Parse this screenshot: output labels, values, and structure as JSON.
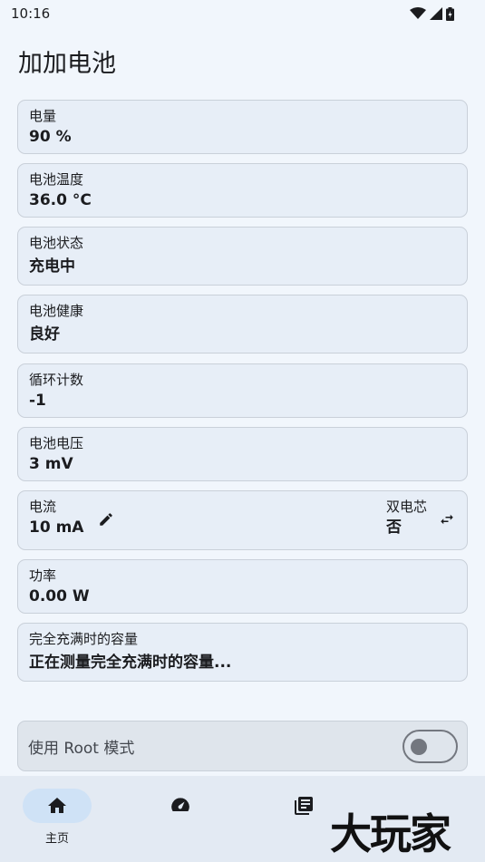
{
  "status": {
    "time": "10:16"
  },
  "app": {
    "title": "加加电池"
  },
  "cards": {
    "level": {
      "label": "电量",
      "value": "90 %"
    },
    "temperature": {
      "label": "电池温度",
      "value": "36.0 °C"
    },
    "status": {
      "label": "电池状态",
      "value": "充电中"
    },
    "health": {
      "label": "电池健康",
      "value": "良好"
    },
    "cycles": {
      "label": "循环计数",
      "value": "-1"
    },
    "voltage": {
      "label": "电池电压",
      "value": "3 mV"
    },
    "current": {
      "label": "电流",
      "value": "10 mA",
      "dual_label": "双电芯",
      "dual_value": "否"
    },
    "power": {
      "label": "功率",
      "value": "0.00 W"
    },
    "full_capacity": {
      "label": "完全充满时的容量",
      "value": "正在测量完全充满时的容量..."
    }
  },
  "root_mode": {
    "label": "使用 Root 模式",
    "enabled": false
  },
  "nav": {
    "items": [
      {
        "label": "主页",
        "icon": "home-icon",
        "active": true
      },
      {
        "label": "",
        "icon": "speedometer-icon",
        "active": false
      },
      {
        "label": "",
        "icon": "history-icon",
        "active": false
      }
    ]
  },
  "watermark": {
    "text": "大玩家"
  }
}
